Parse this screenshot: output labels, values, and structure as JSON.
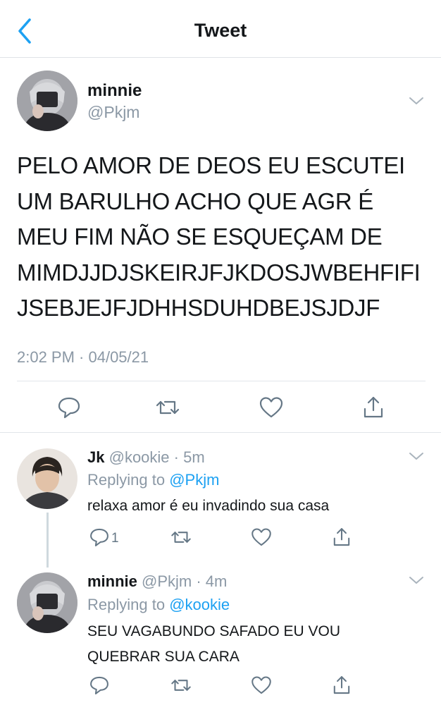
{
  "header": {
    "title": "Tweet",
    "back_icon": "chevron-left-icon",
    "accent": "#1da1f2"
  },
  "main_tweet": {
    "name": "minnie",
    "handle": "@Pkjm",
    "text_lines": [
      "PELO AMOR DE DEOS EU ESCUTEI",
      "UM BARULHO ACHO QUE AGR É",
      "MEU FIM NÃO SE ESQUEÇAM DE",
      "MIMDJJDJSKEIRJFJKDOSJWBEHFIFI",
      "JSEBJEJFJDHHSDUHDBEJSJDJF"
    ],
    "timestamp": "2:02 PM · 04/05/21"
  },
  "replies": [
    {
      "name": "Jk",
      "handle_time": "@kookie · 5m",
      "replying_label": "Replying to",
      "replying_handle": "@Pkjm",
      "text_lines": [
        "relaxa amor é eu invadindo sua casa"
      ],
      "reply_count": "1"
    },
    {
      "name": "minnie",
      "handle_time": "@Pkjm · 4m",
      "replying_label": "Replying to",
      "replying_handle": "@kookie",
      "text_lines": [
        "SEU VAGABUNDO SAFADO EU VOU",
        "QUEBRAR SUA CARA"
      ]
    }
  ]
}
